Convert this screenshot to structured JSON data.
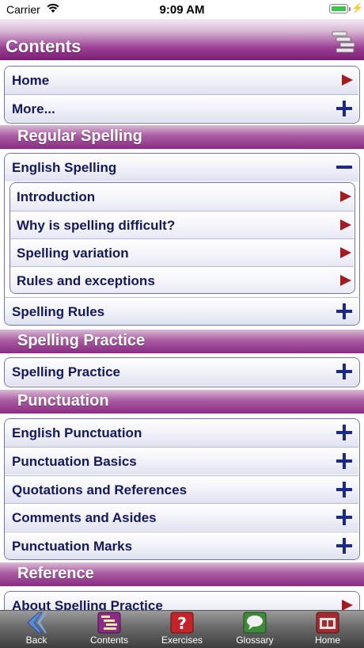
{
  "status_bar": {
    "carrier": "Carrier",
    "time": "9:09 AM"
  },
  "header": {
    "title": "Contents"
  },
  "top_group": [
    {
      "label": "Home",
      "indicator": "arrow"
    },
    {
      "label": "More...",
      "indicator": "plus"
    }
  ],
  "sections": {
    "regular_spelling": "Regular Spelling",
    "spelling_practice": "Spelling Practice",
    "punctuation": "Punctuation",
    "reference": "Reference"
  },
  "regular_spelling_group": {
    "expanded_label": "English Spelling",
    "subitems": [
      {
        "label": "Introduction"
      },
      {
        "label": "Why is spelling difficult?"
      },
      {
        "label": "Spelling variation"
      },
      {
        "label": "Rules and exceptions"
      }
    ],
    "collapsed_label": "Spelling Rules"
  },
  "spelling_practice_group": [
    {
      "label": "Spelling Practice"
    }
  ],
  "punctuation_group": [
    {
      "label": "English Punctuation"
    },
    {
      "label": "Punctuation Basics"
    },
    {
      "label": "Quotations and References"
    },
    {
      "label": "Comments and Asides"
    },
    {
      "label": "Punctuation Marks"
    }
  ],
  "reference_group": [
    {
      "label": "About Spelling Practice"
    }
  ],
  "tabbar": {
    "back": "Back",
    "contents": "Contents",
    "exercises": "Exercises",
    "glossary": "Glossary",
    "home": "Home"
  },
  "colors": {
    "header_purple": "#8a2c83",
    "row_text": "#14185c",
    "plus_blue": "#1a2a8c",
    "arrow_red": "#a31c22"
  }
}
